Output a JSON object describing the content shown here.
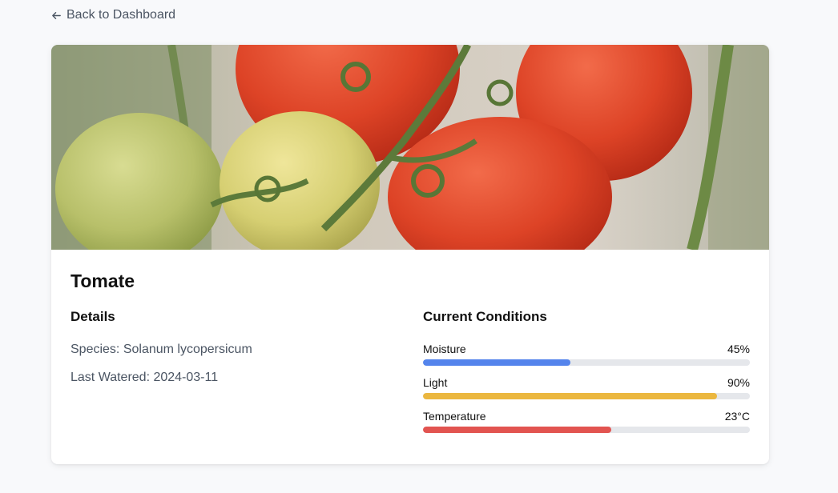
{
  "nav": {
    "back_label": "Back to Dashboard",
    "back_icon": "arrow-left-icon"
  },
  "plant": {
    "name": "Tomate",
    "image": "tomato-photo"
  },
  "details": {
    "title": "Details",
    "species": "Species: Solanum lycopersicum",
    "last_watered": "Last Watered: 2024-03-11"
  },
  "conditions": {
    "title": "Current Conditions",
    "items": [
      {
        "label": "Moisture",
        "value": "45%",
        "level": 0.45,
        "color": "#5484ec"
      },
      {
        "label": "Light",
        "value": "90%",
        "level": 0.9,
        "color": "#ebb73f"
      },
      {
        "label": "Temperature",
        "value": "23°C",
        "level": 0.575,
        "color": "#e25450"
      }
    ]
  }
}
